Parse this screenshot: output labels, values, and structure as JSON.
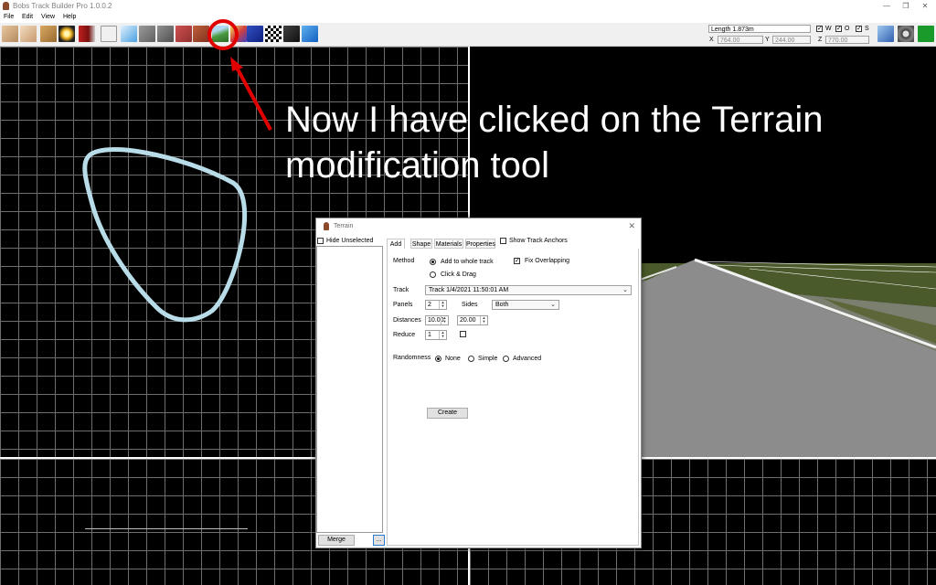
{
  "window": {
    "title": "Bobs Track Builder Pro 1.0.0.2"
  },
  "menu": {
    "items": [
      "File",
      "Edit",
      "View",
      "Help"
    ]
  },
  "readout": {
    "length": "Length 1.873m",
    "x_label": "X",
    "x_value": "764.00",
    "y_label": "Y",
    "y_value": "244.00",
    "z_label": "Z",
    "z_value": "770.00",
    "w_label": "W",
    "o_label": "O",
    "s_label": "S"
  },
  "annotation": {
    "text": "Now I have clicked on the Terrain modification tool",
    "color": "#ffffff",
    "highlight_color": "#e00000"
  },
  "dialog": {
    "title": "Terrain",
    "hide_unselected": "Hide Unselected",
    "show_track_anchors": "Show Track Anchors",
    "tabs": [
      "Add",
      "Shape",
      "Materials",
      "Properties"
    ],
    "method_label": "Method",
    "add_to_whole_track": "Add to whole track",
    "click_and_drag": "Click & Drag",
    "fix_overlapping": "Fix Overlapping",
    "track_label": "Track",
    "track_value": "Track 1/4/2021 11:50:01 AM",
    "panels_label": "Panels",
    "panels_value": "2",
    "sides_label": "Sides",
    "sides_value": "Both",
    "distances_label": "Distances",
    "distance_1": "10.00",
    "distance_2": "20.00",
    "reduce_label": "Reduce",
    "reduce_value": "1",
    "randomness_label": "Randomness",
    "rand_none": "None",
    "rand_simple": "Simple",
    "rand_advanced": "Advanced",
    "create": "Create",
    "merge": "Merge",
    "more": "..."
  },
  "colors": {
    "track_outline": "#b8dce8",
    "grid": "#6e6e6e",
    "grass": "#4a5a2a",
    "road": "#8c8c8c"
  },
  "toolbar_icons": [
    "hand-tool-icon",
    "node-tool-icon",
    "map-icon",
    "sun-icon",
    "flag-icon",
    "road-node-icon",
    "curve-icon",
    "road-icon",
    "paint-icon",
    "wall-icon",
    "object-icon",
    "terrain-icon",
    "paint-brush-icon",
    "checker-flag-icon",
    "camera-icon",
    "water-icon"
  ],
  "right_toolbar_icons": [
    "helicopter-camera-icon",
    "steering-wheel-icon",
    "run-icon"
  ]
}
